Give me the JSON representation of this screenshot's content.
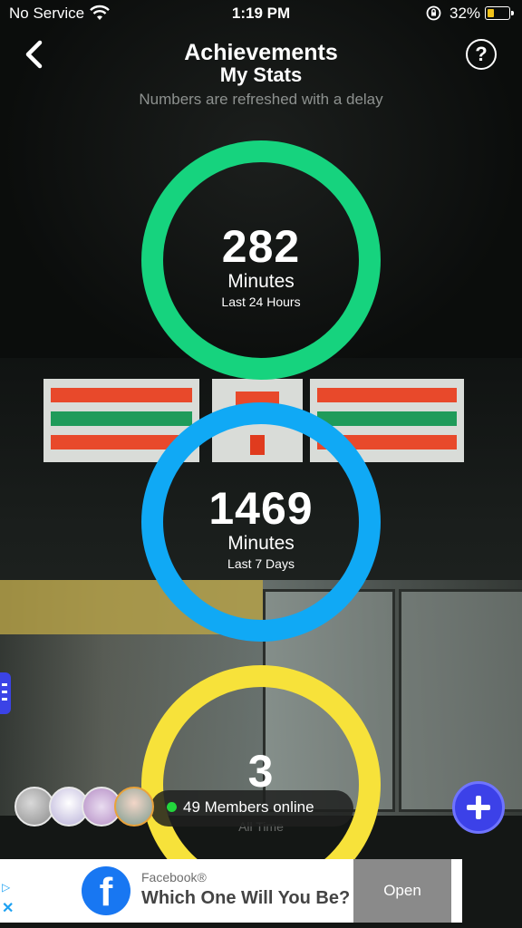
{
  "status_bar": {
    "carrier": "No Service",
    "time": "1:19 PM",
    "battery_percent": "32%",
    "battery_level": 0.32,
    "icons": [
      "wifi-icon",
      "orientation-lock-icon",
      "battery-icon"
    ]
  },
  "header": {
    "title": "Achievements",
    "subtitle": "My Stats",
    "note": "Numbers are refreshed with a delay",
    "back_icon": "chevron-left-icon",
    "help_label": "?"
  },
  "stats": [
    {
      "value": "282",
      "unit": "Minutes",
      "period": "Last 24 Hours",
      "color": "#16d37e"
    },
    {
      "value": "1469",
      "unit": "Minutes",
      "period": "Last 7 Days",
      "color": "#10a9f5"
    },
    {
      "value": "3",
      "unit": "",
      "period": "All Time",
      "color": "#f7e23a"
    }
  ],
  "members": {
    "online_text": "49 Members online",
    "online_color": "#22d63c",
    "avatars": [
      "avatar-1",
      "avatar-2",
      "avatar-3",
      "avatar-4"
    ]
  },
  "fab": {
    "icon": "plus-icon",
    "color": "#3c41e8"
  },
  "ad": {
    "brand": "Facebook®",
    "headline": "Which One Will You Be?",
    "cta": "Open",
    "logo_glyph": "f",
    "logo_color": "#1877f2"
  }
}
